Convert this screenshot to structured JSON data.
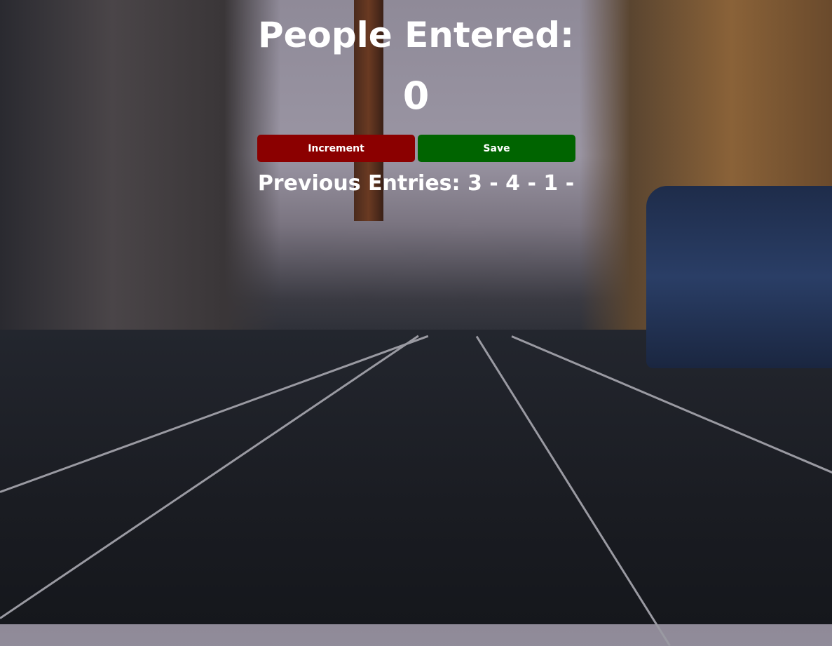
{
  "header": {
    "title": "People Entered:"
  },
  "counter": {
    "value": "0"
  },
  "buttons": {
    "increment_label": "Increment",
    "save_label": "Save"
  },
  "history": {
    "text": "Previous Entries: 3 - 4 - 1 -"
  },
  "colors": {
    "increment": "#8b0000",
    "save": "#006400"
  }
}
